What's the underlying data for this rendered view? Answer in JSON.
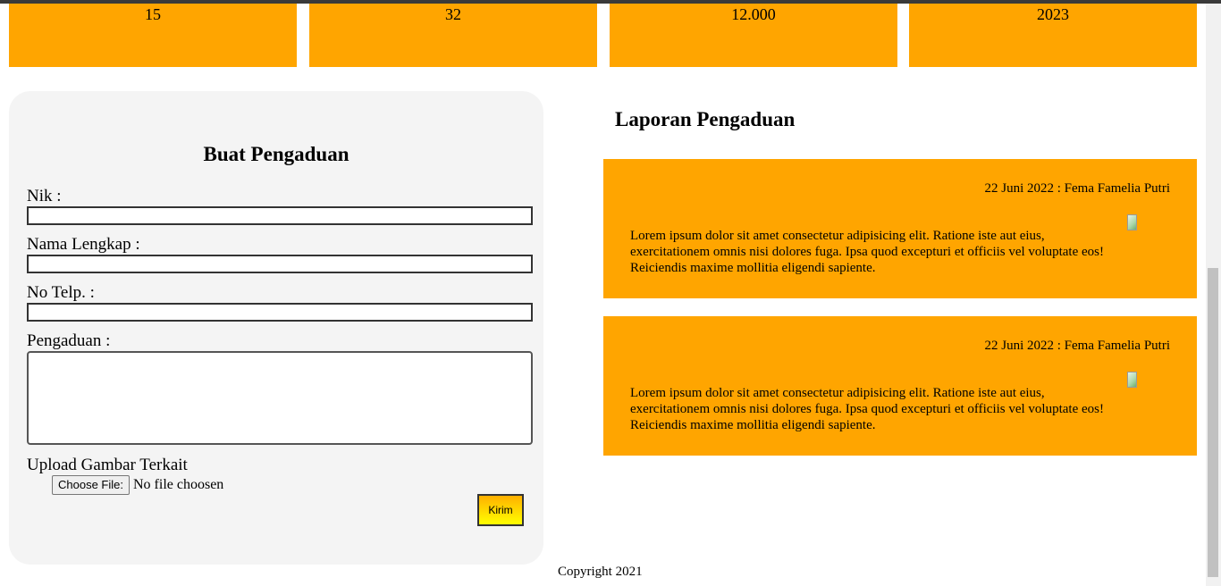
{
  "stats": [
    "15",
    "32",
    "12.000",
    "2023"
  ],
  "form": {
    "title": "Buat Pengaduan",
    "nik_label": "Nik :",
    "nama_label": "Nama Lengkap :",
    "telp_label": "No Telp. :",
    "pengaduan_label": "Pengaduan :",
    "upload_label": "Upload Gambar Terkait",
    "choose_file": "Choose File:",
    "no_file": "No file choosen",
    "submit": "Kirim"
  },
  "reports": {
    "title": "Laporan Pengaduan",
    "items": [
      {
        "meta": "22 Juni 2022 : Fema Famelia Putri",
        "body": "Lorem ipsum dolor sit amet consectetur adipisicing elit. Ratione iste aut eius, exercitationem omnis nisi dolores fuga. Ipsa quod excepturi et officiis vel voluptate eos! Reiciendis maxime mollitia eligendi sapiente."
      },
      {
        "meta": "22 Juni 2022 : Fema Famelia Putri",
        "body": "Lorem ipsum dolor sit amet consectetur adipisicing elit. Ratione iste aut eius, exercitationem omnis nisi dolores fuga. Ipsa quod excepturi et officiis vel voluptate eos! Reiciendis maxime mollitia eligendi sapiente."
      }
    ]
  },
  "footer": "Copyright 2021",
  "colors": {
    "accent": "#ffa500",
    "card": "#f4f4f4"
  }
}
